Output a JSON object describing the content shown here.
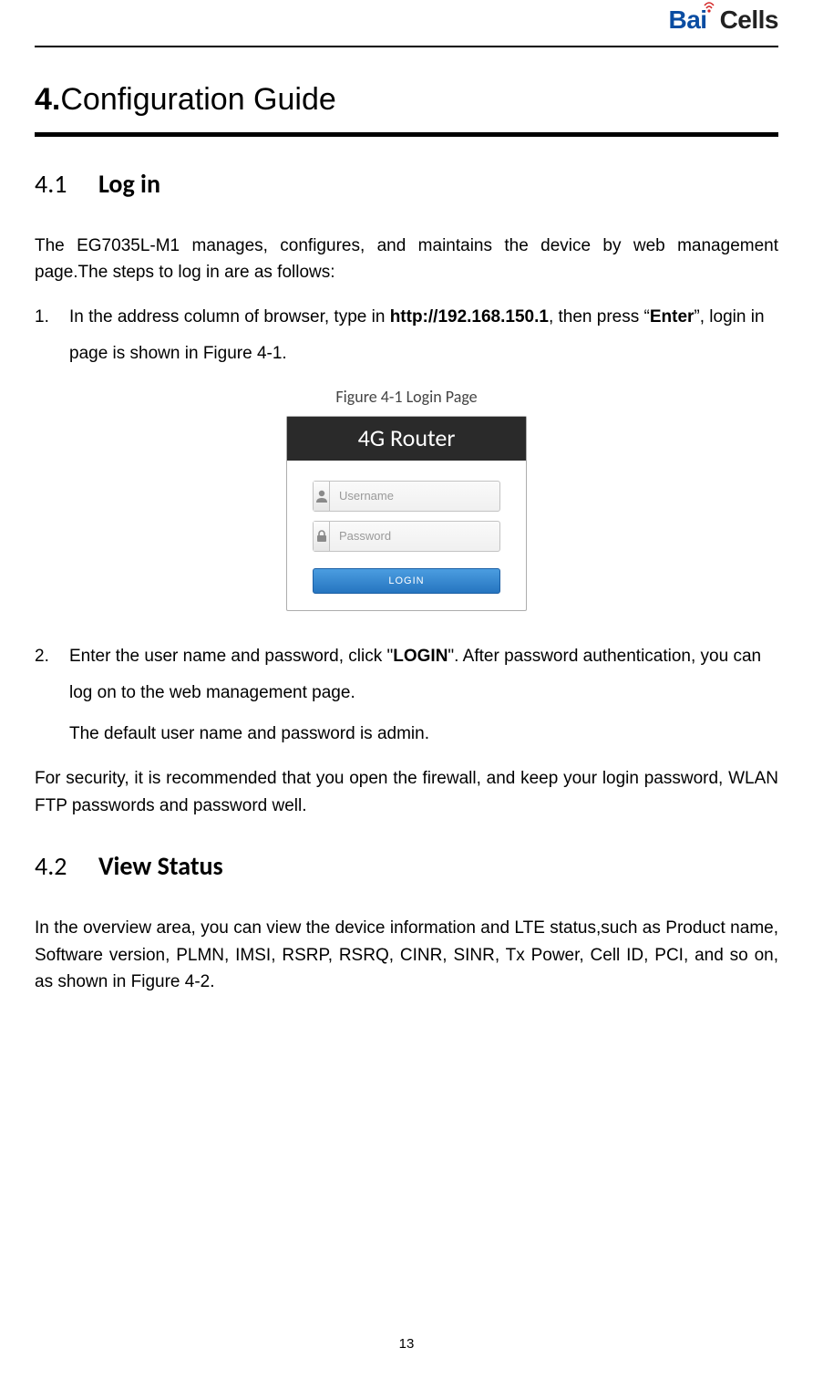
{
  "logo": {
    "part1": "Bai",
    "part2": "Cells"
  },
  "h1": {
    "num": "4.",
    "text": "Configuration Guide"
  },
  "sec41": {
    "num": "4.1",
    "title": "Log in",
    "intro": "The EG7035L-M1 manages, configures, and maintains the device by web management page.The steps to log in are as follows:",
    "step1_num": "1.",
    "step1_a": "In the address column of browser, type in ",
    "step1_url": "http://192.168.150.1",
    "step1_b": ", then press “",
    "step1_enter": "Enter",
    "step1_c": "”, login in page is shown in Figure 4-1.",
    "figcap": "Figure 4-1 Login Page",
    "fig_title": "4G Router",
    "username_ph": "Username",
    "password_ph": "Password",
    "login_btn": "LOGIN",
    "step2_num": "2.",
    "step2_a": "Enter the user name and password, click \"",
    "step2_login": "LOGIN",
    "step2_b": "\". After password authentication, you can log on to the web management page.",
    "step2_c": "The default user name and password is admin.",
    "security": "For security, it is recommended that you open the firewall, and keep your login password, WLAN FTP passwords and password well."
  },
  "sec42": {
    "num": "4.2",
    "title": "View Status",
    "body": "In the overview area, you can view the device information and LTE status,such as Product name, Software version, PLMN, IMSI, RSRP, RSRQ, CINR, SINR, Tx Power, Cell ID, PCI, and so on, as shown in Figure 4-2."
  },
  "page_num": "13"
}
